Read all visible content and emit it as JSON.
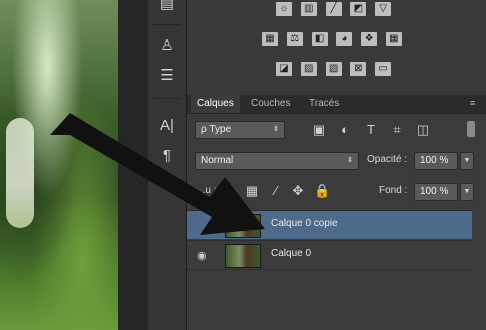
{
  "tabs": [
    "Calques",
    "Couches",
    "Tracés"
  ],
  "layers_panel": {
    "filter_label": "ρ Type",
    "blend_mode": "Normal",
    "opacity_label": "Opacité :",
    "opacity_value": "100 %",
    "lock_label": "...u :",
    "fill_label": "Fond :",
    "fill_value": "100 %"
  },
  "layers": [
    {
      "name": "Calque 0 copie",
      "selected": true,
      "visible_eye": false
    },
    {
      "name": "Calque 0",
      "selected": false,
      "visible_eye": true
    }
  ],
  "tools": [
    "hand-tool-icon",
    "paint-tool-icon",
    "text-tool-icon",
    "paragraph-tool-icon",
    "more-tool-icon"
  ],
  "adjust_icons": {
    "row1": [
      "brightness-icon",
      "levels-icon",
      "curves-icon",
      "exposure-icon",
      "vibrance-icon"
    ],
    "row2": [
      "hsl-icon",
      "color-balance-icon",
      "bw-icon",
      "photo-filter-icon",
      "channel-mixer-icon",
      "color-lookup-icon"
    ],
    "row3": [
      "invert-icon",
      "posterize-icon",
      "threshold-icon",
      "selective-color-icon",
      "gradient-map-icon"
    ]
  },
  "colors": {
    "selection": "#4d6a8a",
    "panel_bg": "#3b3b3b",
    "arrow": "#111111"
  }
}
